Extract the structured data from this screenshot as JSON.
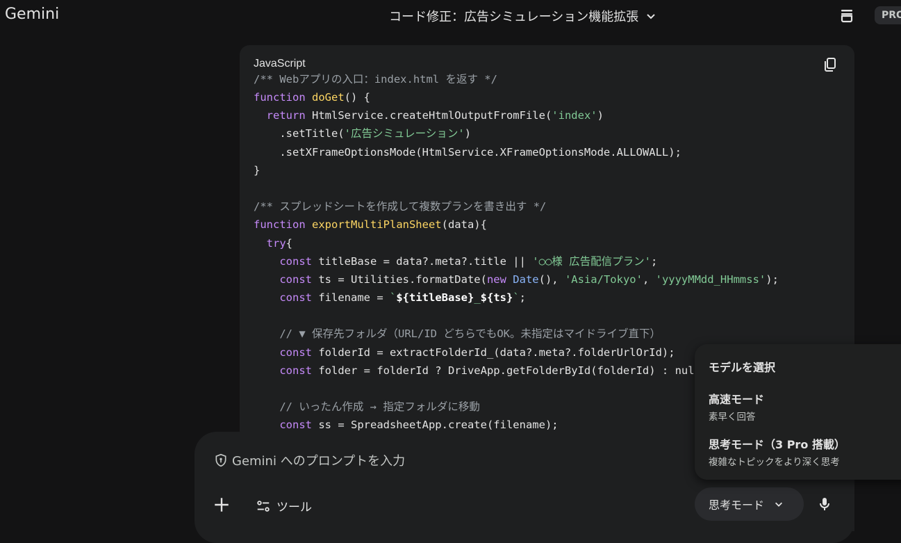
{
  "app": {
    "logo": "Gemini",
    "chat_title": "コード修正：広告シミュレーション機能拡張",
    "pro_label": "PRO"
  },
  "code_block": {
    "language": "JavaScript",
    "lines": [
      [
        [
          "cm",
          "/** Webアプリの入口：index.html を返す */"
        ]
      ],
      [
        [
          "kw",
          "function "
        ],
        [
          "fn",
          "doGet"
        ],
        [
          "pl",
          "() {"
        ]
      ],
      [
        [
          "pl",
          "  "
        ],
        [
          "kw",
          "return "
        ],
        [
          "pl",
          "HtmlService.createHtmlOutputFromFile("
        ],
        [
          "st",
          "'index'"
        ],
        [
          "pl",
          ")"
        ]
      ],
      [
        [
          "pl",
          "    .setTitle("
        ],
        [
          "st",
          "'広告シミュレーション'"
        ],
        [
          "pl",
          ")"
        ]
      ],
      [
        [
          "pl",
          "    .setXFrameOptionsMode(HtmlService.XFrameOptionsMode.ALLOWALL);"
        ]
      ],
      [
        [
          "pl",
          "}"
        ]
      ],
      [
        [
          "pl",
          ""
        ]
      ],
      [
        [
          "cm",
          "/** スプレッドシートを作成して複数プランを書き出す */"
        ]
      ],
      [
        [
          "kw",
          "function "
        ],
        [
          "fn",
          "exportMultiPlanSheet"
        ],
        [
          "pl",
          "(data){"
        ]
      ],
      [
        [
          "pl",
          "  "
        ],
        [
          "kw",
          "try"
        ],
        [
          "pl",
          "{"
        ]
      ],
      [
        [
          "pl",
          "    "
        ],
        [
          "kw",
          "const "
        ],
        [
          "pl",
          "titleBase = data?.meta?.title || "
        ],
        [
          "st",
          "'○○様 広告配信プラン'"
        ],
        [
          "pl",
          ";"
        ]
      ],
      [
        [
          "pl",
          "    "
        ],
        [
          "kw",
          "const "
        ],
        [
          "pl",
          "ts = Utilities.formatDate("
        ],
        [
          "kw",
          "new "
        ],
        [
          "bl",
          "Date"
        ],
        [
          "pl",
          "(), "
        ],
        [
          "st",
          "'Asia/Tokyo'"
        ],
        [
          "pl",
          ", "
        ],
        [
          "st",
          "'yyyyMMdd_HHmmss'"
        ],
        [
          "pl",
          ");"
        ]
      ],
      [
        [
          "pl",
          "    "
        ],
        [
          "kw",
          "const "
        ],
        [
          "pl",
          "filename = "
        ],
        [
          "st",
          "`"
        ],
        [
          "tb",
          "${titleBase}"
        ],
        [
          "st",
          "_"
        ],
        [
          "tb",
          "${ts}"
        ],
        [
          "st",
          "`"
        ],
        [
          "pl",
          ";"
        ]
      ],
      [
        [
          "pl",
          ""
        ]
      ],
      [
        [
          "pl",
          "    "
        ],
        [
          "cm",
          "// ▼ 保存先フォルダ（URL/ID どちらでもOK。未指定はマイドライブ直下）"
        ]
      ],
      [
        [
          "pl",
          "    "
        ],
        [
          "kw",
          "const "
        ],
        [
          "pl",
          "folderId = extractFolderId_(data?.meta?.folderUrlOrId);"
        ]
      ],
      [
        [
          "pl",
          "    "
        ],
        [
          "kw",
          "const "
        ],
        [
          "pl",
          "folder = folderId ? DriveApp.getFolderById(folderId) : null;"
        ]
      ],
      [
        [
          "pl",
          ""
        ]
      ],
      [
        [
          "pl",
          "    "
        ],
        [
          "cm",
          "// いったん作成 → 指定フォルダに移動"
        ]
      ],
      [
        [
          "pl",
          "    "
        ],
        [
          "kw",
          "const "
        ],
        [
          "pl",
          "ss = SpreadsheetApp.create(filename);"
        ]
      ]
    ]
  },
  "prompt": {
    "placeholder": "Gemini へのプロンプトを入力",
    "tools_label": "ツール",
    "mode_label": "思考モード"
  },
  "model_menu": {
    "heading": "モデルを選択",
    "items": [
      {
        "title": "高速モード",
        "subtitle": "素早く回答"
      },
      {
        "title": "思考モード（3 Pro 搭載）",
        "subtitle": "複雑なトピックをより深く思考"
      }
    ]
  }
}
